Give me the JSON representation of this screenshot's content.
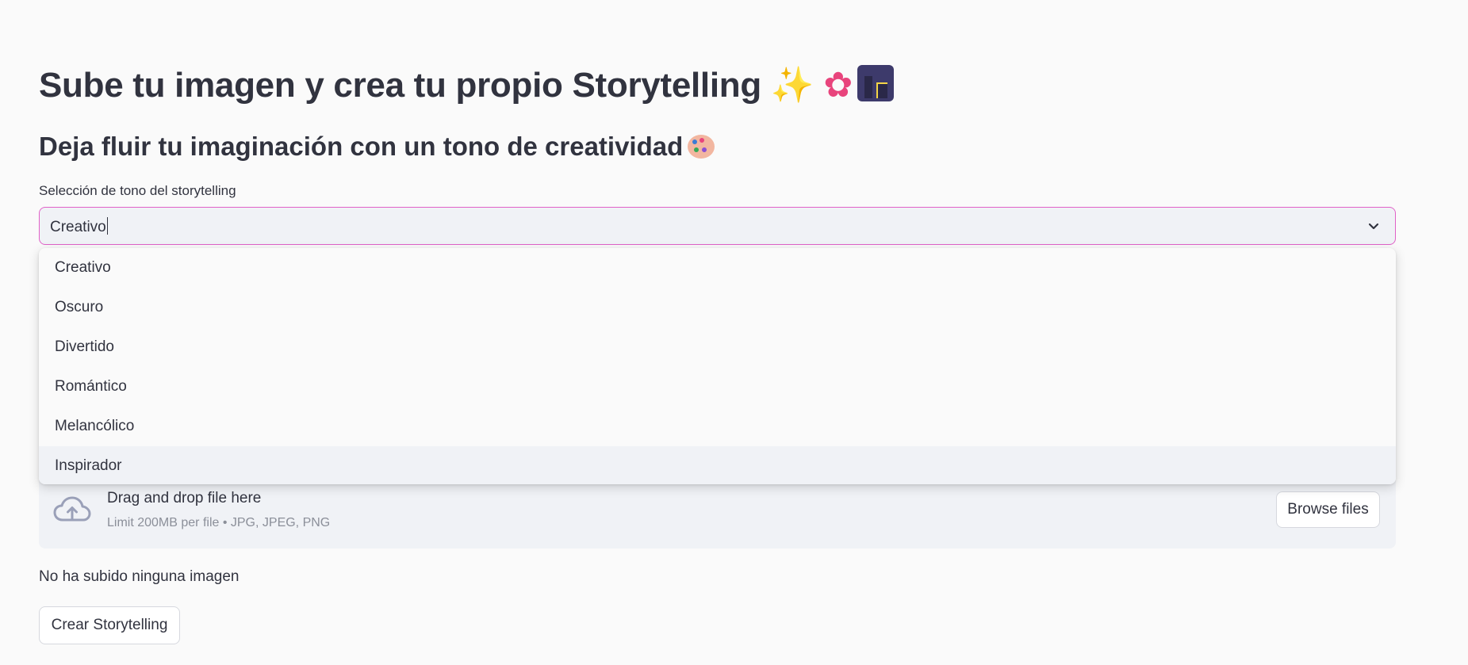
{
  "header": {
    "title": "Sube tu imagen y crea tu propio Storytelling",
    "title_emojis": [
      "sparkles-emoji",
      "flower-emoji",
      "night-city-emoji"
    ],
    "subtitle": "Deja fluir tu imaginación con un tono de creatividad",
    "subtitle_emoji": "palette-emoji"
  },
  "tone_select": {
    "label": "Selección de tono del storytelling",
    "value": "Creativo",
    "options": [
      "Creativo",
      "Oscuro",
      "Divertido",
      "Romántico",
      "Melancólico",
      "Inspirador"
    ],
    "highlighted_option": "Inspirador"
  },
  "uploader": {
    "drop_text": "Drag and drop file here",
    "limit_text": "Limit 200MB per file • JPG, JPEG, PNG",
    "browse_label": "Browse files"
  },
  "status": {
    "message": "No ha subido ninguna imagen"
  },
  "actions": {
    "create_label": "Crear Storytelling"
  },
  "colors": {
    "accent_border": "#e062c8",
    "background": "#fafafa",
    "input_background": "#f0f2f6",
    "text": "#31333f"
  }
}
